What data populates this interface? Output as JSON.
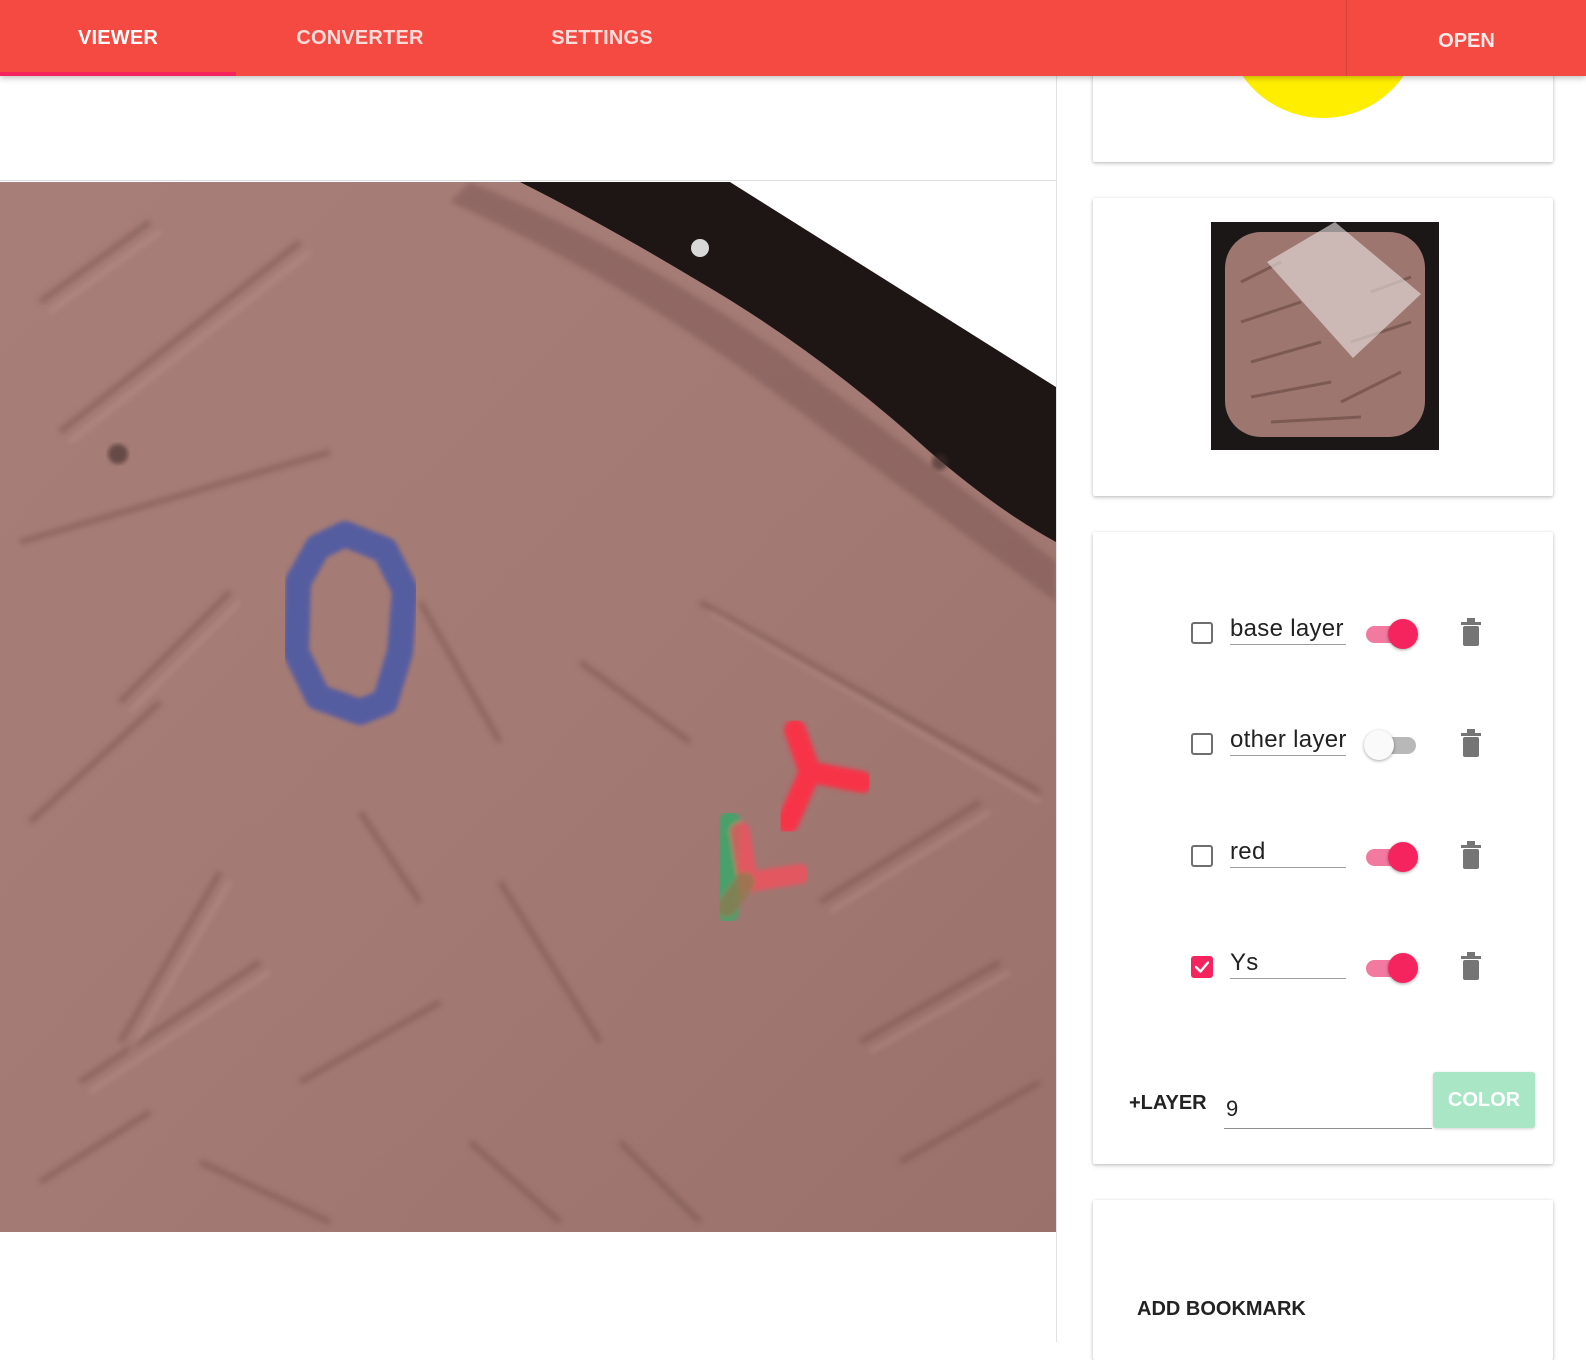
{
  "nav": {
    "tabs": [
      {
        "label": "VIEWER",
        "active": true
      },
      {
        "label": "CONVERTER",
        "active": false
      },
      {
        "label": "SETTINGS",
        "active": false
      }
    ],
    "open_label": "OPEN"
  },
  "colors": {
    "appbar": "#f44a42",
    "accent": "#f5245f",
    "color_button": "#a8e6c6",
    "annotation_blue": "#4d5aa6",
    "annotation_red": "#ff2f45",
    "annotation_green": "#3aa76a"
  },
  "layers": [
    {
      "name": "base layer",
      "selected": false,
      "visible": true
    },
    {
      "name": "other layer",
      "selected": false,
      "visible": false
    },
    {
      "name": "red",
      "selected": false,
      "visible": true
    },
    {
      "name": "Ys",
      "selected": true,
      "visible": true
    }
  ],
  "add_layer": {
    "label": "+LAYER",
    "value": "9",
    "color_button_label": "COLOR"
  },
  "bookmark": {
    "add_label": "ADD BOOKMARK"
  },
  "icons": {
    "delete": "trash-icon",
    "check": "check-icon"
  }
}
